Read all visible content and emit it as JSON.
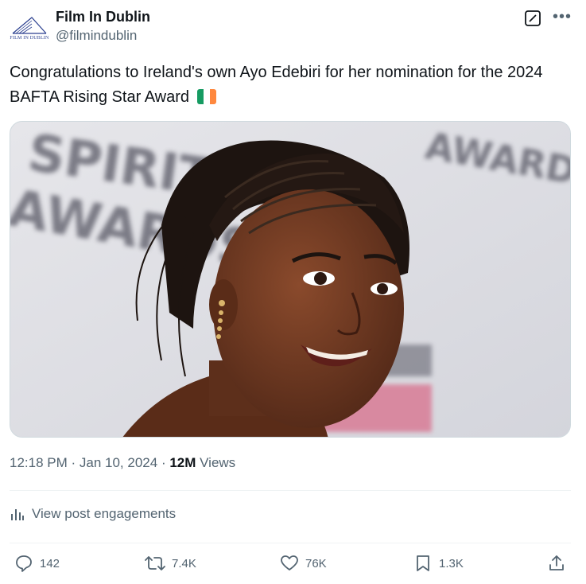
{
  "account": {
    "display_name": "Film In Dublin",
    "handle": "@filmindublin",
    "avatar_text": "FILM IN DUBLIN"
  },
  "tweet": {
    "text": "Congratulations to Ireland's own Ayo Edebiri for her nomination for the 2024 BAFTA Rising Star Award",
    "flag_colors": [
      "#169b62",
      "#ffffff",
      "#ff883e"
    ]
  },
  "media": {
    "backdrop_words": [
      "SPIRIT",
      "AWARDS",
      "AWARDS"
    ]
  },
  "meta": {
    "time": "12:18 PM",
    "date": "Jan 10, 2024",
    "views_count": "12M",
    "views_label": "Views"
  },
  "engagements": {
    "label": "View post engagements"
  },
  "actions": {
    "replies": "142",
    "reposts": "7.4K",
    "likes": "76K",
    "bookmarks": "1.3K"
  },
  "colors": {
    "secondary_text": "#536471",
    "primary_text": "#0f1419",
    "divider": "#eff3f4"
  }
}
